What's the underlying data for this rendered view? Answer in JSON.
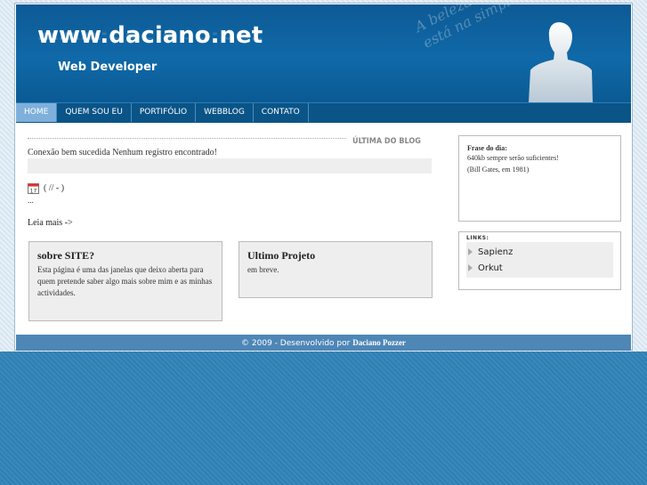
{
  "header": {
    "title": "www.daciano.net",
    "subtitle": "Web Developer",
    "motto_line1": "A beleza ideal",
    "motto_line2": "está na simplicidade"
  },
  "nav": {
    "items": [
      {
        "label": "HOME",
        "active": true
      },
      {
        "label": "QUEM SOU EU",
        "active": false
      },
      {
        "label": "PORTIFÓLIO",
        "active": false
      },
      {
        "label": "WEBBLOG",
        "active": false
      },
      {
        "label": "CONTATO",
        "active": false
      }
    ]
  },
  "blog": {
    "section_label": "ÚLTIMA DO BLOG",
    "error_text": "Conexão bem sucedida Nenhum registro encontrado!",
    "calendar_day": "17",
    "date_text": "( // - )",
    "ellipsis": "...",
    "read_more": "Leia mais ->"
  },
  "about_box": {
    "title": "sobre SITE?",
    "text": "Esta página é uma das janelas que deixo aberta para quem pretende saber algo mais sobre mim e as minhas actividades."
  },
  "project_box": {
    "title": "Ultimo Projeto",
    "text": "em breve."
  },
  "quote": {
    "title": "Frase do dia:",
    "line1": "640kb sempre serão suficientes!",
    "line2": "(Bill Gates, em 1981)"
  },
  "links": {
    "title": "LINKS:",
    "items": [
      "Sapienz",
      "Orkut"
    ]
  },
  "footer": {
    "text": "© 2009 - Desenvolvido por ",
    "author": "Daciano Pozzer"
  },
  "colors": {
    "header_blue": "#0d5a95",
    "nav_active": "#7fb0dc",
    "footer_bar": "#4e86b6",
    "background": "#2f7fb3"
  }
}
